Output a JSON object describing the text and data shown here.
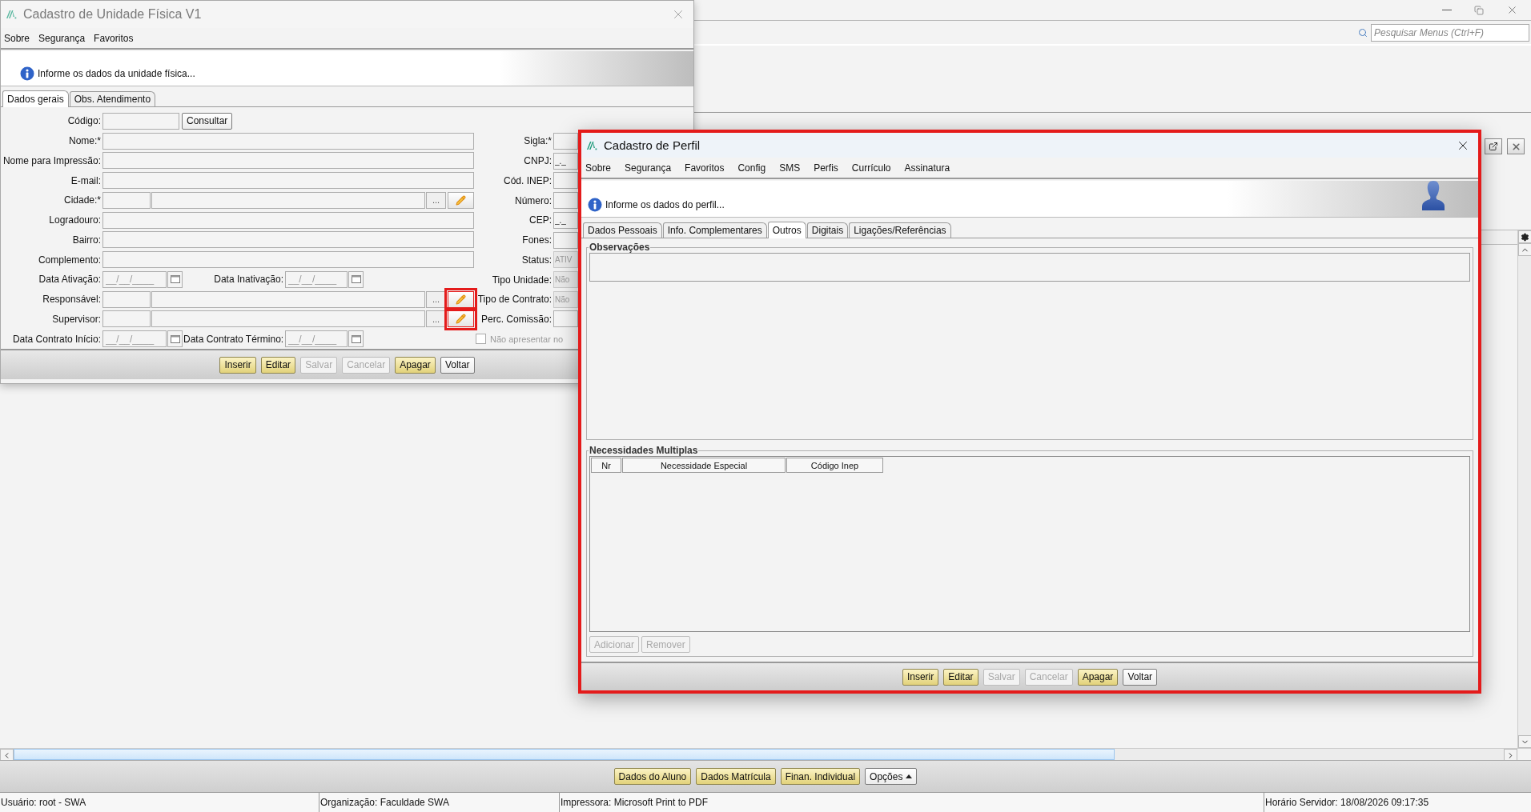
{
  "main": {
    "search": {
      "placeholder": "Pesquisar Menus (Ctrl+F)"
    },
    "action_buttons": [
      {
        "label": "Dados do Aluno",
        "kind": "primary"
      },
      {
        "label": "Dados Matrícula",
        "kind": "primary"
      },
      {
        "label": "Finan. Individual",
        "kind": "primary"
      },
      {
        "label": "Opções",
        "kind": "menu"
      }
    ],
    "status_bar": [
      "Usuário: root - SWA",
      "Organização: Faculdade SWA",
      "Impressora: Microsoft Print to PDF",
      "Horário Servidor: 18/08/2026 09:17:35"
    ]
  },
  "unidade_window": {
    "title": "Cadastro de Unidade Física V1",
    "menu": [
      "Sobre",
      "Segurança",
      "Favoritos"
    ],
    "info": "Informe os dados da unidade física...",
    "tabs": [
      {
        "label": "Dados gerais",
        "selected": true
      },
      {
        "label": "Obs. Atendimento",
        "selected": false
      }
    ],
    "fields": [
      {
        "kind": "code-search",
        "label": "Código:",
        "button": "Consultar"
      },
      {
        "kind": "text",
        "label": "Nome:*"
      },
      {
        "kind": "text",
        "label": "Nome para Impressão:"
      },
      {
        "kind": "text",
        "label": "E-mail:"
      },
      {
        "kind": "lookup",
        "label": "Cidade:*",
        "browse": "...",
        "highlighted": false
      },
      {
        "kind": "text",
        "label": "Logradouro:"
      },
      {
        "kind": "text",
        "label": "Bairro:"
      },
      {
        "kind": "text",
        "label": "Complemento:"
      },
      {
        "kind": "dates",
        "label": "Data Ativação:",
        "placeholder": "__/__/____",
        "label2": "Data Inativação:",
        "placeholder2": "__/__/____"
      },
      {
        "kind": "lookup",
        "label": "Responsável:",
        "browse": "...",
        "highlighted": true
      },
      {
        "kind": "lookup",
        "label": "Supervisor:",
        "browse": "...",
        "highlighted": true
      },
      {
        "kind": "dates",
        "label": "Data Contrato Início:",
        "placeholder": "__/__/____",
        "label2": "Data Contrato Término:",
        "placeholder2": "__/__/____"
      }
    ],
    "right_fields": [
      {
        "kind": "field",
        "label": "Sigla:*",
        "disabled": false
      },
      {
        "kind": "field",
        "label": "CNPJ:",
        "value": "_._",
        "disabled": false
      },
      {
        "kind": "field",
        "label": "Cód. INEP:",
        "disabled": false
      },
      {
        "kind": "field",
        "label": "Número:",
        "disabled": false
      },
      {
        "kind": "field",
        "label": "CEP:",
        "value": "_._",
        "disabled": false
      },
      {
        "kind": "field",
        "label": "Fones:",
        "disabled": false
      },
      {
        "kind": "field",
        "label": "Status:",
        "value": "ATIV",
        "disabled": true
      },
      {
        "kind": "field",
        "label": "Tipo Unidade:",
        "value": "Não",
        "disabled": true
      },
      {
        "kind": "field",
        "label": "Tipo de Contrato:",
        "value": "Não",
        "disabled": true
      },
      {
        "kind": "field",
        "label": "Perc. Comissão:",
        "disabled": false
      },
      {
        "kind": "checkbox",
        "label": "Não apresentar no",
        "checked": false,
        "disabled": true
      }
    ],
    "buttons": [
      {
        "label": "Inserir",
        "kind": "primary",
        "disabled": false
      },
      {
        "label": "Editar",
        "kind": "primary",
        "disabled": false
      },
      {
        "label": "Salvar",
        "kind": "normal",
        "disabled": true
      },
      {
        "label": "Cancelar",
        "kind": "normal",
        "disabled": true
      },
      {
        "label": "Apagar",
        "kind": "primary",
        "disabled": false
      },
      {
        "label": "Voltar",
        "kind": "normal",
        "disabled": false
      }
    ]
  },
  "perfil_window": {
    "title": "Cadastro de Perfil",
    "highlighted": true,
    "menu": [
      "Sobre",
      "Segurança",
      "Favoritos",
      "Config",
      "SMS",
      "Perfis",
      "Currículo",
      "Assinatura"
    ],
    "info": "Informe os dados do perfil...",
    "tabs": [
      {
        "label": "Dados Pessoais",
        "selected": false
      },
      {
        "label": "Info. Complementares",
        "selected": false
      },
      {
        "label": "Outros",
        "selected": true
      },
      {
        "label": "Digitais",
        "selected": false
      },
      {
        "label": "Ligações/Referências",
        "selected": false
      }
    ],
    "notes_group": {
      "title": "Observações"
    },
    "needs_group": {
      "title": "Necessidades Multiplas",
      "columns": [
        "Nr",
        "Necessidade Especial",
        "Código Inep"
      ],
      "buttons": [
        {
          "label": "Adicionar",
          "disabled": true
        },
        {
          "label": "Remover",
          "disabled": true
        }
      ]
    },
    "buttons": [
      {
        "label": "Inserir",
        "kind": "primary",
        "disabled": false
      },
      {
        "label": "Editar",
        "kind": "primary",
        "disabled": false
      },
      {
        "label": "Salvar",
        "kind": "normal",
        "disabled": true
      },
      {
        "label": "Cancelar",
        "kind": "normal",
        "disabled": true
      },
      {
        "label": "Apagar",
        "kind": "primary",
        "disabled": false
      },
      {
        "label": "Voltar",
        "kind": "normal",
        "disabled": false
      }
    ]
  }
}
